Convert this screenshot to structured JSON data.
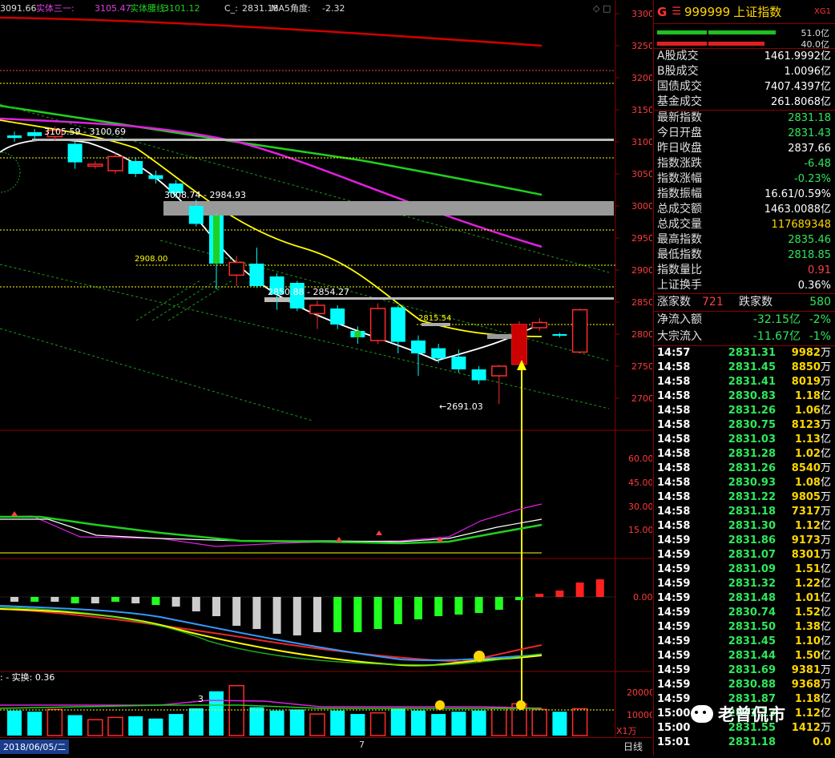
{
  "header": {
    "ma_left": "3091.66",
    "ma_label_1": "实体三一: ",
    "ma_value_1": "3105.47",
    "ma_label_2": "实体腰线: ",
    "ma_value_2": "3101.12",
    "c_label": "C_: ",
    "c_value": "2831.18",
    "ma5_angle_label": "MA5角度: ",
    "ma5_angle_value": "-2.32"
  },
  "price_axis": [
    "3300",
    "3250",
    "3200",
    "3150",
    "3100",
    "3050",
    "3000",
    "2950",
    "2900",
    "2850",
    "2800",
    "2750",
    "2700"
  ],
  "indicator1_axis": [
    "60.00",
    "45.00",
    "30.00",
    "15.00"
  ],
  "macd_axis": [
    "0.00"
  ],
  "volume_axis": [
    "20000",
    "10000"
  ],
  "volume_unit": "X1万",
  "annotations": {
    "resistance1": "3105.59 - 3100.69",
    "resistance2": "3008.74 - 2984.93",
    "level_2908": "2908.00",
    "support_2850": "2850.88 - 2854.27",
    "level_2815": "2815.54",
    "low_point": "←2691.03",
    "vol_label": "3",
    "turnover_label": ": - 实换: 0.36"
  },
  "bottom": {
    "date": "2018/06/05/二",
    "period": "日线",
    "seven": "7"
  },
  "panel": {
    "g": "G",
    "menu": "☰",
    "code": "999999",
    "name": "上证指数",
    "xg": "XG1",
    "buy_amount": "51.0亿",
    "sell_amount": "40.0亿",
    "turnover_rows": [
      {
        "k": "A股成交",
        "v": "1461.9992亿"
      },
      {
        "k": "B股成交",
        "v": "1.0096亿"
      },
      {
        "k": "国债成交",
        "v": "7407.4397亿"
      },
      {
        "k": "基金成交",
        "v": "261.8068亿"
      }
    ],
    "quote_rows": [
      {
        "k": "最新指数",
        "v": "2831.18",
        "c": "green"
      },
      {
        "k": "今日开盘",
        "v": "2831.43",
        "c": "green"
      },
      {
        "k": "昨日收盘",
        "v": "2837.66",
        "c": ""
      },
      {
        "k": "指数涨跌",
        "v": "-6.48",
        "c": "green"
      },
      {
        "k": "指数涨幅",
        "v": "-0.23%",
        "c": "green"
      },
      {
        "k": "指数振幅",
        "v": "16.61/0.59%",
        "c": ""
      },
      {
        "k": "总成交额",
        "v": "1463.0088亿",
        "c": ""
      },
      {
        "k": "总成交量",
        "v": "117689348",
        "c": "yellow"
      },
      {
        "k": "最高指数",
        "v": "2835.46",
        "c": "green"
      },
      {
        "k": "最低指数",
        "v": "2818.85",
        "c": "green"
      },
      {
        "k": "指数量比",
        "v": "0.91",
        "c": "red"
      },
      {
        "k": "上证换手",
        "v": "0.36%",
        "c": ""
      }
    ],
    "up_label": "涨家数",
    "up_value": "721",
    "down_label": "跌家数",
    "down_value": "580",
    "flows": [
      {
        "k": "净流入额",
        "v": "-32.15亿",
        "p": "-2%"
      },
      {
        "k": "大宗流入",
        "v": "-11.67亿",
        "p": "-1%"
      }
    ],
    "ticks": [
      {
        "t": "14:57",
        "p": "2831.31",
        "v": "9982",
        "u": "万"
      },
      {
        "t": "14:58",
        "p": "2831.45",
        "v": "8850",
        "u": "万"
      },
      {
        "t": "14:58",
        "p": "2831.41",
        "v": "8019",
        "u": "万"
      },
      {
        "t": "14:58",
        "p": "2830.83",
        "v": "1.18",
        "u": "亿"
      },
      {
        "t": "14:58",
        "p": "2831.26",
        "v": "1.06",
        "u": "亿"
      },
      {
        "t": "14:58",
        "p": "2830.75",
        "v": "8123",
        "u": "万"
      },
      {
        "t": "14:58",
        "p": "2831.03",
        "v": "1.13",
        "u": "亿"
      },
      {
        "t": "14:58",
        "p": "2831.28",
        "v": "1.02",
        "u": "亿"
      },
      {
        "t": "14:58",
        "p": "2831.26",
        "v": "8540",
        "u": "万"
      },
      {
        "t": "14:58",
        "p": "2830.93",
        "v": "1.08",
        "u": "亿"
      },
      {
        "t": "14:58",
        "p": "2831.22",
        "v": "9805",
        "u": "万"
      },
      {
        "t": "14:58",
        "p": "2831.18",
        "v": "7317",
        "u": "万"
      },
      {
        "t": "14:58",
        "p": "2831.30",
        "v": "1.12",
        "u": "亿"
      },
      {
        "t": "14:59",
        "p": "2831.86",
        "v": "9173",
        "u": "万"
      },
      {
        "t": "14:59",
        "p": "2831.07",
        "v": "8301",
        "u": "万"
      },
      {
        "t": "14:59",
        "p": "2831.09",
        "v": "1.51",
        "u": "亿"
      },
      {
        "t": "14:59",
        "p": "2831.32",
        "v": "1.22",
        "u": "亿"
      },
      {
        "t": "14:59",
        "p": "2831.48",
        "v": "1.01",
        "u": "亿"
      },
      {
        "t": "14:59",
        "p": "2830.74",
        "v": "1.52",
        "u": "亿"
      },
      {
        "t": "14:59",
        "p": "2831.50",
        "v": "1.38",
        "u": "亿"
      },
      {
        "t": "14:59",
        "p": "2831.45",
        "v": "1.10",
        "u": "亿"
      },
      {
        "t": "14:59",
        "p": "2831.44",
        "v": "1.50",
        "u": "亿"
      },
      {
        "t": "14:59",
        "p": "2831.69",
        "v": "9381",
        "u": "万"
      },
      {
        "t": "14:59",
        "p": "2830.88",
        "v": "9368",
        "u": "万"
      },
      {
        "t": "14:59",
        "p": "2831.87",
        "v": "1.18",
        "u": "亿"
      },
      {
        "t": "15:00",
        "p": "2831.13",
        "v": "1.12",
        "u": "亿"
      },
      {
        "t": "15:00",
        "p": "2831.55",
        "v": "1412",
        "u": "万"
      },
      {
        "t": "15:01",
        "p": "2831.18",
        "v": "0.0",
        "u": ""
      }
    ]
  },
  "watermark": "老曾侃市",
  "colors": {
    "up": "#ff2b2b",
    "down": "#00ffff",
    "ma_yellow": "#ffff00",
    "ma_magenta": "#e020e0",
    "ma_green": "#20d020",
    "ma_red": "#d00000"
  },
  "chart_data": {
    "type": "candlestick",
    "ylim": [
      2680,
      3310
    ],
    "candles": [
      {
        "o": 3110,
        "c": 3106,
        "h": 3116,
        "l": 3100
      },
      {
        "o": 3115,
        "c": 3109,
        "h": 3120,
        "l": 3104
      },
      {
        "o": 3108,
        "c": 3118,
        "h": 3124,
        "l": 3102
      },
      {
        "o": 3097,
        "c": 3068,
        "h": 3100,
        "l": 3058
      },
      {
        "o": 3062,
        "c": 3065,
        "h": 3070,
        "l": 3058
      },
      {
        "o": 3055,
        "c": 3077,
        "h": 3083,
        "l": 3050
      },
      {
        "o": 3070,
        "c": 3050,
        "h": 3075,
        "l": 3045
      },
      {
        "o": 3048,
        "c": 3042,
        "h": 3055,
        "l": 3035
      },
      {
        "o": 3035,
        "c": 3020,
        "h": 3040,
        "l": 3012
      },
      {
        "o": 3000,
        "c": 2972,
        "h": 3010,
        "l": 2968
      },
      {
        "o": 2985,
        "c": 2910,
        "h": 2988,
        "l": 2870
      },
      {
        "o": 2892,
        "c": 2912,
        "h": 2922,
        "l": 2875
      },
      {
        "o": 2910,
        "c": 2875,
        "h": 2935,
        "l": 2872
      },
      {
        "o": 2890,
        "c": 2862,
        "h": 2895,
        "l": 2838
      },
      {
        "o": 2880,
        "c": 2840,
        "h": 2883,
        "l": 2836
      },
      {
        "o": 2832,
        "c": 2845,
        "h": 2852,
        "l": 2808
      },
      {
        "o": 2840,
        "c": 2815,
        "h": 2845,
        "l": 2808
      },
      {
        "o": 2805,
        "c": 2795,
        "h": 2812,
        "l": 2785
      },
      {
        "o": 2790,
        "c": 2840,
        "h": 2848,
        "l": 2785
      },
      {
        "o": 2842,
        "c": 2788,
        "h": 2845,
        "l": 2770
      },
      {
        "o": 2790,
        "c": 2770,
        "h": 2798,
        "l": 2735
      },
      {
        "o": 2778,
        "c": 2762,
        "h": 2785,
        "l": 2755
      },
      {
        "o": 2765,
        "c": 2745,
        "h": 2776,
        "l": 2740
      },
      {
        "o": 2745,
        "c": 2728,
        "h": 2750,
        "l": 2722
      },
      {
        "o": 2735,
        "c": 2750,
        "h": 2752,
        "l": 2691
      },
      {
        "o": 2753,
        "c": 2815,
        "h": 2820,
        "l": 2752
      },
      {
        "o": 2810,
        "c": 2818,
        "h": 2825,
        "l": 2805
      },
      {
        "o": 2800,
        "c": 2799,
        "h": 2802,
        "l": 2795
      },
      {
        "o": 2772,
        "c": 2838,
        "h": 2840,
        "l": 2770
      }
    ],
    "volume": [
      11000,
      10500,
      11500,
      9000,
      7000,
      8000,
      8500,
      7500,
      9500,
      12000,
      19500,
      22000,
      12500,
      11000,
      11500,
      9500,
      11000,
      9500,
      10000,
      12000,
      11000,
      9500,
      10500,
      11000,
      12500,
      14000,
      11500,
      10500,
      11800
    ],
    "macd": [
      -3,
      -3,
      -3,
      -4,
      -4,
      -3,
      -4,
      -5,
      -6,
      -9,
      -12,
      -18,
      -20,
      -23,
      -24,
      -22,
      -22,
      -22,
      -20,
      -17,
      -14,
      -12,
      -11,
      -10,
      -8,
      -2,
      2,
      4,
      9,
      11
    ]
  }
}
